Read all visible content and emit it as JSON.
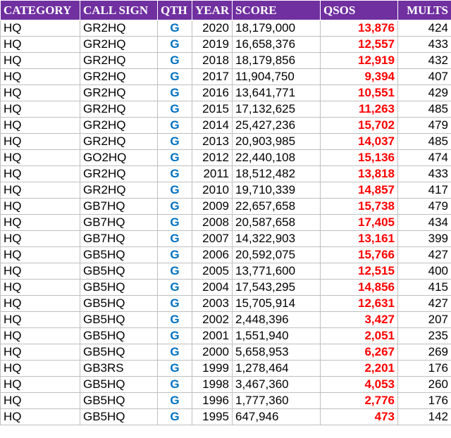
{
  "headers": {
    "category": "CATEGORY",
    "call_sign": "CALL SIGN",
    "qth": "QTH",
    "year": "YEAR",
    "score": "SCORE",
    "qsos": "QSOS",
    "mults": "MULTS"
  },
  "colors": {
    "header_bg": "#7030a0",
    "header_text": "#ffffff",
    "qth_text": "#0070c0",
    "qsos_text": "#ff0000"
  },
  "rows": [
    {
      "category": "HQ",
      "call_sign": "GR2HQ",
      "qth": "G",
      "year": "2020",
      "score": "18,179,000",
      "qsos": "13,876",
      "mults": "424"
    },
    {
      "category": "HQ",
      "call_sign": "GR2HQ",
      "qth": "G",
      "year": "2019",
      "score": "16,658,376",
      "qsos": "12,557",
      "mults": "433"
    },
    {
      "category": "HQ",
      "call_sign": "GR2HQ",
      "qth": "G",
      "year": "2018",
      "score": "18,179,856",
      "qsos": "12,919",
      "mults": "432"
    },
    {
      "category": "HQ",
      "call_sign": "GR2HQ",
      "qth": "G",
      "year": "2017",
      "score": "11,904,750",
      "qsos": "9,394",
      "mults": "407"
    },
    {
      "category": "HQ",
      "call_sign": "GR2HQ",
      "qth": "G",
      "year": "2016",
      "score": "13,641,771",
      "qsos": "10,551",
      "mults": "429"
    },
    {
      "category": "HQ",
      "call_sign": "GR2HQ",
      "qth": "G",
      "year": "2015",
      "score": "17,132,625",
      "qsos": "11,263",
      "mults": "485"
    },
    {
      "category": "HQ",
      "call_sign": "GR2HQ",
      "qth": "G",
      "year": "2014",
      "score": "25,427,236",
      "qsos": "15,702",
      "mults": "479"
    },
    {
      "category": "HQ",
      "call_sign": "GR2HQ",
      "qth": "G",
      "year": "2013",
      "score": "20,903,985",
      "qsos": "14,037",
      "mults": "485"
    },
    {
      "category": "HQ",
      "call_sign": "GO2HQ",
      "qth": "G",
      "year": "2012",
      "score": "22,440,108",
      "qsos": "15,136",
      "mults": "474"
    },
    {
      "category": "HQ",
      "call_sign": "GR2HQ",
      "qth": "G",
      "year": "2011",
      "score": "18,512,482",
      "qsos": "13,818",
      "mults": "433"
    },
    {
      "category": "HQ",
      "call_sign": "GR2HQ",
      "qth": "G",
      "year": "2010",
      "score": "19,710,339",
      "qsos": "14,857",
      "mults": "417"
    },
    {
      "category": "HQ",
      "call_sign": "GB7HQ",
      "qth": "G",
      "year": "2009",
      "score": "22,657,658",
      "qsos": "15,738",
      "mults": "479"
    },
    {
      "category": "HQ",
      "call_sign": "GB7HQ",
      "qth": "G",
      "year": "2008",
      "score": "20,587,658",
      "qsos": "17,405",
      "mults": "434"
    },
    {
      "category": "HQ",
      "call_sign": "GB7HQ",
      "qth": "G",
      "year": "2007",
      "score": "14,322,903",
      "qsos": "13,161",
      "mults": "399"
    },
    {
      "category": "HQ",
      "call_sign": "GB5HQ",
      "qth": "G",
      "year": "2006",
      "score": "20,592,075",
      "qsos": "15,766",
      "mults": "427"
    },
    {
      "category": "HQ",
      "call_sign": "GB5HQ",
      "qth": "G",
      "year": "2005",
      "score": "13,771,600",
      "qsos": "12,515",
      "mults": "400"
    },
    {
      "category": "HQ",
      "call_sign": "GB5HQ",
      "qth": "G",
      "year": "2004",
      "score": "17,543,295",
      "qsos": "14,856",
      "mults": "415"
    },
    {
      "category": "HQ",
      "call_sign": "GB5HQ",
      "qth": "G",
      "year": "2003",
      "score": "15,705,914",
      "qsos": "12,631",
      "mults": "427"
    },
    {
      "category": "HQ",
      "call_sign": "GB5HQ",
      "qth": "G",
      "year": "2002",
      "score": "2,448,396",
      "qsos": "3,427",
      "mults": "207"
    },
    {
      "category": "HQ",
      "call_sign": "GB5HQ",
      "qth": "G",
      "year": "2001",
      "score": "1,551,940",
      "qsos": "2,051",
      "mults": "235"
    },
    {
      "category": "HQ",
      "call_sign": "GB5HQ",
      "qth": "G",
      "year": "2000",
      "score": "5,658,953",
      "qsos": "6,267",
      "mults": "269"
    },
    {
      "category": "HQ",
      "call_sign": "GB3RS",
      "qth": "G",
      "year": "1999",
      "score": "1,278,464",
      "qsos": "2,201",
      "mults": "176"
    },
    {
      "category": "HQ",
      "call_sign": "GB5HQ",
      "qth": "G",
      "year": "1998",
      "score": "3,467,360",
      "qsos": "4,053",
      "mults": "260"
    },
    {
      "category": "HQ",
      "call_sign": "GB5HQ",
      "qth": "G",
      "year": "1996",
      "score": "1,777,360",
      "qsos": "2,776",
      "mults": "176"
    },
    {
      "category": "HQ",
      "call_sign": "GB5HQ",
      "qth": "G",
      "year": "1995",
      "score": "647,946",
      "qsos": "473",
      "mults": "142"
    }
  ]
}
